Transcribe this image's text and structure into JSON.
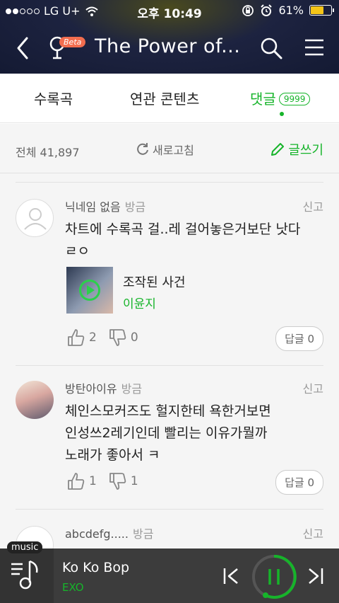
{
  "status": {
    "carrier": "LG U+",
    "time": "오후 10:49",
    "battery": "61%"
  },
  "header": {
    "title": "The Power of...",
    "beta": "Beta"
  },
  "tabs": [
    {
      "label": "수록곡"
    },
    {
      "label": "연관 콘텐츠"
    },
    {
      "label": "댓글",
      "badge": "9999"
    }
  ],
  "toolbar": {
    "total": "전체 41,897",
    "refresh": "새로고침",
    "write": "글쓰기"
  },
  "comments": [
    {
      "nickname": "닉네임 없음",
      "time": "방금",
      "report": "신고",
      "body": [
        "차트에 수록곡 걸..레 걸어놓은거보단 낫다",
        "ㄹㅇ"
      ],
      "song": {
        "title": "조작된 사건",
        "artist": "이윤지"
      },
      "likes": "2",
      "dislikes": "0",
      "reply": "답글 0"
    },
    {
      "nickname": "방탄아이유",
      "time": "방금",
      "report": "신고",
      "body": [
        "체인스모커즈도 헐지한테 욕한거보면",
        "인성쓰2레기인데 빨리는 이유가뭘까",
        "노래가 좋아서 ㅋ"
      ],
      "likes": "1",
      "dislikes": "1",
      "reply": "답글 0"
    },
    {
      "nickname": "abcdefg.....",
      "time": "방금",
      "report": "신고"
    }
  ],
  "player": {
    "tag": "music",
    "title": "Ko Ko Bop",
    "artist": "EXO"
  },
  "colors": {
    "accent": "#16b42a",
    "header_bg": "#1d2340",
    "player_bg": "#3c3c3c"
  }
}
